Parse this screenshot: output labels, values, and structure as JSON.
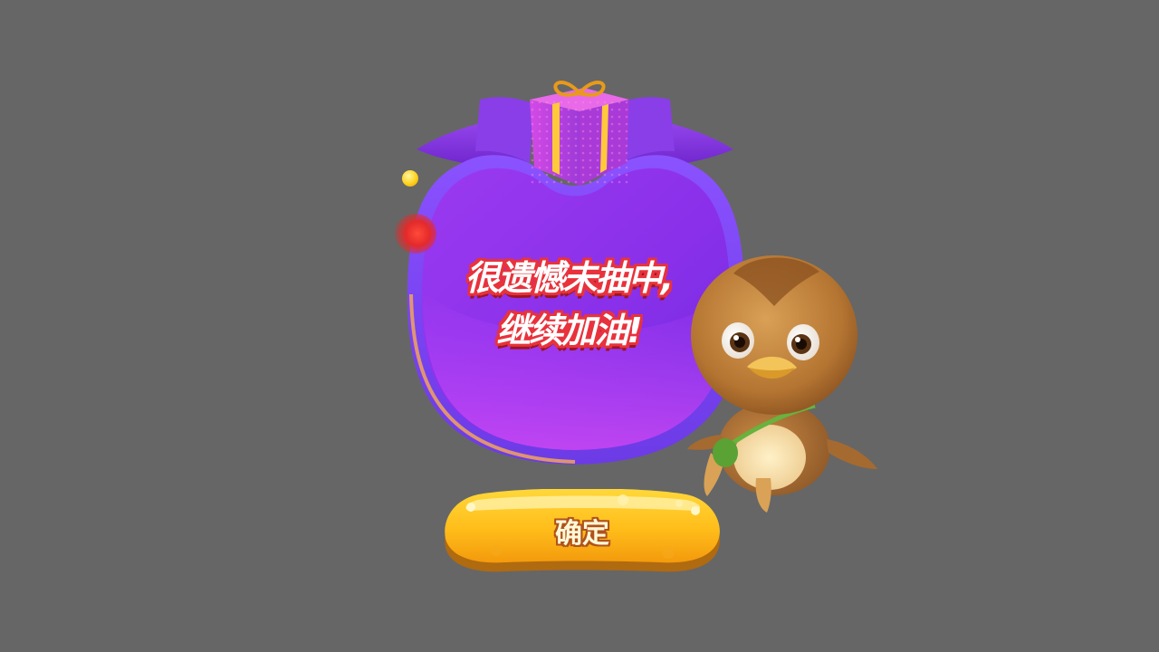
{
  "popup": {
    "message_line1": "很遗憾未抽中,",
    "message_line2": "继续加油!",
    "confirm_label": "确定"
  },
  "colors": {
    "background": "#666666",
    "bag_purple": "#8e3bf0",
    "bag_gradient_end": "#b43ce6",
    "message_outline": "#e8323c",
    "button_yellow": "#ffc21e",
    "button_orange": "#f39a0c"
  },
  "icons": {
    "gift_box": "gift-box-icon",
    "mascot": "duckling-mascot",
    "coin": "coin-icon"
  }
}
